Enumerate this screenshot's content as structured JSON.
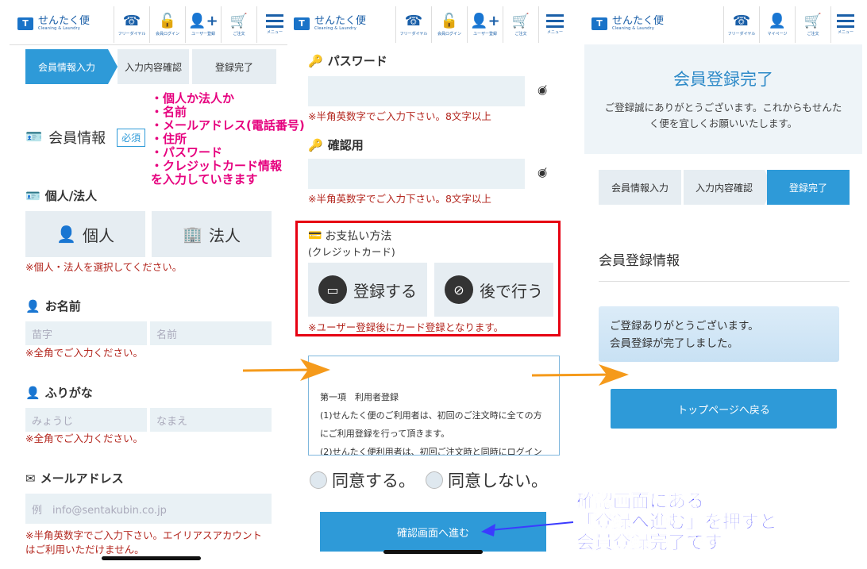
{
  "header": {
    "logo_main": "せんたく便",
    "logo_sub": "Cleaning & Laundry",
    "icons_p1": [
      "フリーダイヤル",
      "会員ログイン",
      "ユーザー登録",
      "ご注文",
      "メニュー"
    ],
    "icons_p3": [
      "フリーダイヤル",
      "マイページ",
      "ご注文",
      "メニュー"
    ]
  },
  "steps": [
    "会員情報入力",
    "入力内容確認",
    "登録完了"
  ],
  "panel1": {
    "section_title": "会員情報",
    "required_badge": "必須",
    "type_label": "個人/法人",
    "individual": "個人",
    "corporate": "法人",
    "type_error": "※個人・法人を選択してください。",
    "name_label": "お名前",
    "name_last_ph": "苗字",
    "name_first_ph": "名前",
    "name_error": "※全角でご入力ください。",
    "furigana_label": "ふりがな",
    "furi_last_ph": "みょうじ",
    "furi_first_ph": "なまえ",
    "furi_error": "※全角でご入力ください。",
    "email_label": "メールアドレス",
    "email_ph": "例　info@sentakubin.co.jp",
    "email_error_1": "※半角英数字でご入力下さい。エイリアスアカウント",
    "email_error_2": "はご利用いただけません。",
    "annotation": [
      "・個人か法人か",
      "・名前",
      "・メールアドレス(電話番号)",
      "・住所",
      "・パスワード",
      "・クレジットカード情報",
      "  を入力していきます"
    ]
  },
  "panel2": {
    "password_label": "パスワード",
    "password_error": "※半角英数字でご入力下さい。8文字以上",
    "confirm_label": "確認用",
    "confirm_error": "※半角英数字でご入力下さい。8文字以上",
    "payment_title": "お支払い方法",
    "payment_sub": "(クレジットカード)",
    "register_now": "登録する",
    "register_later": "後で行う",
    "payment_note": "※ユーザー登録後にカード登録となります。",
    "terms_lines": [
      "第一項　利用者登録",
      "(1)せんたく便のご利用者は、初回のご注文時に全ての方",
      "にご利用登録を行って頂きます。",
      "(2)せんたく便利用者は、初回ご注文時と同時にログイン"
    ],
    "agree": "同意する。",
    "disagree": "同意しない。",
    "confirm_button": "確認画面へ進む"
  },
  "panel3": {
    "title": "会員登録完了",
    "thanks_1": "ご登録誠にありがとうございます。これからもせんた",
    "thanks_2": "く便を宜しくお願いいたします。",
    "info_title": "会員登録情報",
    "notice_1": "ご登録ありがとうございます。",
    "notice_2": "会員登録が完了しました。",
    "top_button": "トップページへ戻る"
  },
  "annotation_bottom": [
    "確認画面にある",
    "「登録へ進む」を押すと",
    "会員登録完了です"
  ],
  "colors": {
    "accent": "#2e9ad8",
    "error": "#b3261e",
    "highlight_box": "#e60012",
    "annotation_pink": "#e6007e",
    "annotation_blue": "#3b3bff",
    "arrow": "#f59a1b"
  }
}
